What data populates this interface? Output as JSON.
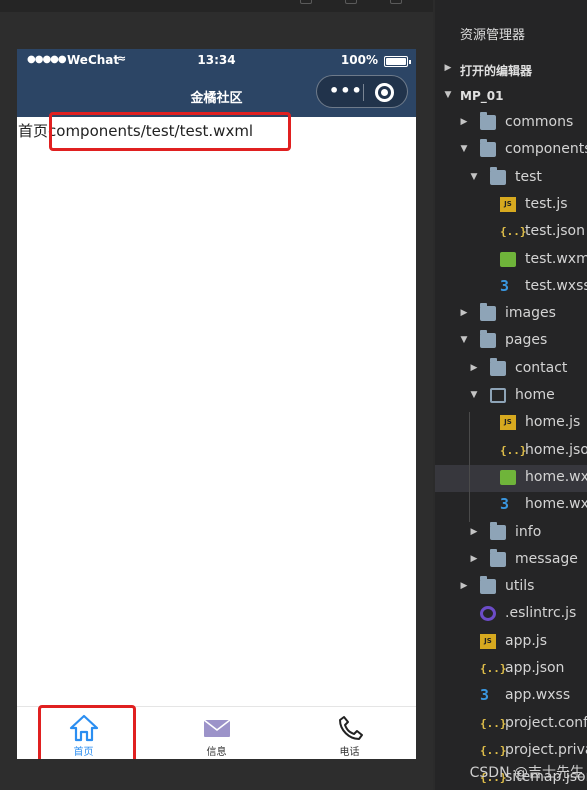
{
  "phone": {
    "status": {
      "signal": "●●●●●",
      "carrier": "WeChat",
      "wifi": "≈",
      "time": "13:34",
      "battery_pct": "100%",
      "battery_level": 1.0
    },
    "nav_title": "金橘社区",
    "capsule_more": "•••",
    "content_prefix": "首页",
    "content_path": "components/test/test.wxml",
    "tabs": [
      {
        "label": "首页",
        "icon": "home-icon",
        "active": true
      },
      {
        "label": "信息",
        "icon": "mail-icon",
        "active": false
      },
      {
        "label": "电话",
        "icon": "phone-icon",
        "active": false
      }
    ]
  },
  "explorer": {
    "header": "资源管理器",
    "open_editors": "打开的编辑器",
    "project": "MP_01",
    "tree": [
      {
        "label": "commons",
        "icon": "folder-icon",
        "arrow": "▶"
      },
      {
        "label": "components",
        "icon": "folder-icon",
        "arrow": "▼"
      },
      {
        "label": "test",
        "icon": "folder-icon",
        "arrow": "▼"
      },
      {
        "label": "test.js",
        "icon": "js-file-icon",
        "arrow": ""
      },
      {
        "label": "test.json",
        "icon": "json-file-icon",
        "arrow": ""
      },
      {
        "label": "test.wxml",
        "icon": "wxml-file-icon",
        "arrow": ""
      },
      {
        "label": "test.wxss",
        "icon": "wxss-file-icon",
        "arrow": ""
      },
      {
        "label": "images",
        "icon": "folder-icon",
        "arrow": "▶"
      },
      {
        "label": "pages",
        "icon": "folder-icon",
        "arrow": "▼"
      },
      {
        "label": "contact",
        "icon": "folder-icon",
        "arrow": "▶"
      },
      {
        "label": "home",
        "icon": "folder-open-icon",
        "arrow": "▼"
      },
      {
        "label": "home.js",
        "icon": "js-file-icon",
        "arrow": ""
      },
      {
        "label": "home.json",
        "icon": "json-file-icon",
        "arrow": ""
      },
      {
        "label": "home.wxml",
        "icon": "wxml-file-icon",
        "arrow": "",
        "selected": true
      },
      {
        "label": "home.wxss",
        "icon": "wxss-file-icon",
        "arrow": ""
      },
      {
        "label": "info",
        "icon": "folder-icon",
        "arrow": "▶"
      },
      {
        "label": "message",
        "icon": "folder-icon",
        "arrow": "▶"
      },
      {
        "label": "utils",
        "icon": "folder-icon",
        "arrow": "▶"
      },
      {
        "label": ".eslintrc.js",
        "icon": "eslint-file-icon",
        "arrow": ""
      },
      {
        "label": "app.js",
        "icon": "js-file-icon",
        "arrow": ""
      },
      {
        "label": "app.json",
        "icon": "json-file-icon",
        "arrow": ""
      },
      {
        "label": "app.wxss",
        "icon": "wxss-file-icon",
        "arrow": ""
      },
      {
        "label": "project.config.json",
        "icon": "json-file-icon",
        "arrow": ""
      },
      {
        "label": "project.private.config.json",
        "icon": "json-file-icon",
        "arrow": ""
      },
      {
        "label": "sitemap.json",
        "icon": "json-file-icon",
        "arrow": ""
      }
    ],
    "watermark": "CSDN @吉士先生"
  },
  "colors": {
    "nav_bg": "#2c4565",
    "tab_active": "#2b8ef1",
    "highlight_box": "#e02020",
    "explorer_bg": "#252526"
  }
}
